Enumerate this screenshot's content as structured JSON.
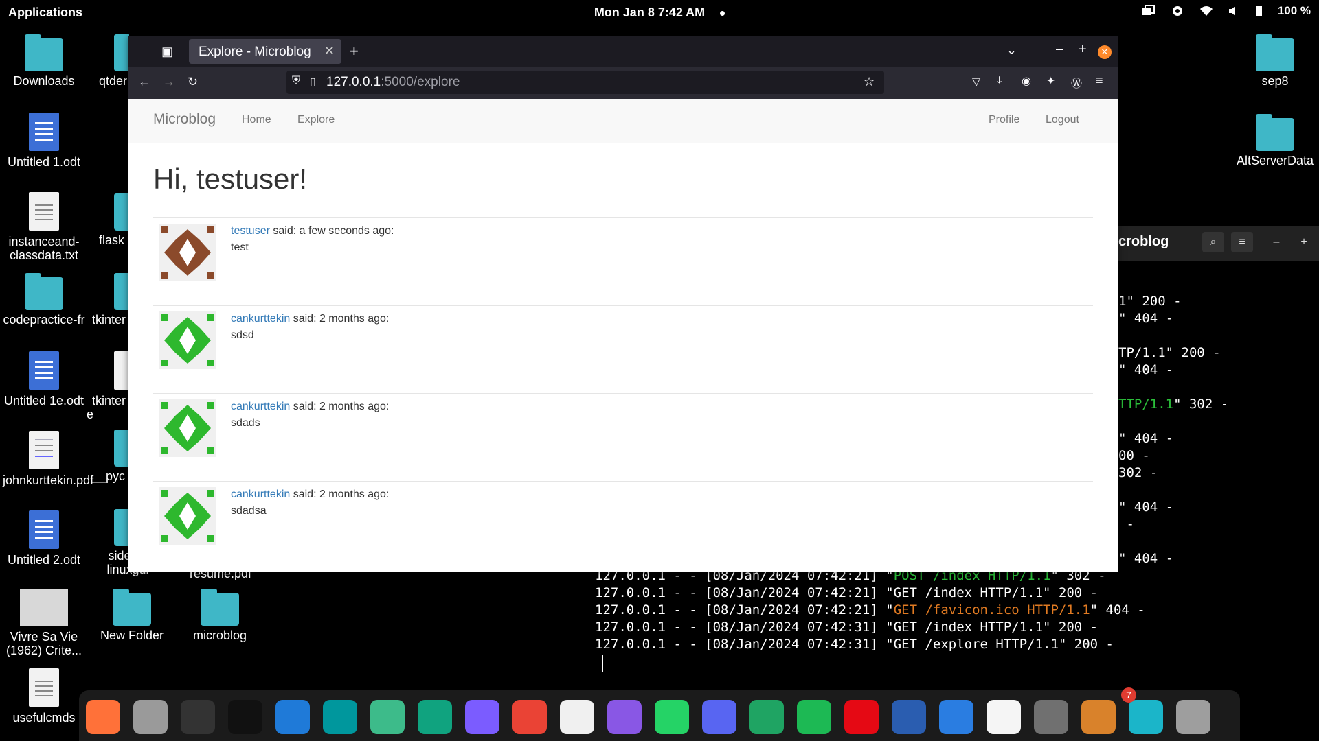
{
  "topbar": {
    "applications": "Applications",
    "datetime": "Mon Jan 8   7:42 AM",
    "battery": "100 %"
  },
  "desktop_icons": [
    {
      "label": "Downloads"
    },
    {
      "label": "Untitled 1.odt"
    },
    {
      "label": "instanceand-classdata.txt"
    },
    {
      "label": "codepractice-fr"
    },
    {
      "label": "Untitled 1e.odt"
    },
    {
      "label": "johnkurttekin.pdf"
    },
    {
      "label": "Untitled 2.odt"
    },
    {
      "label": "Vivre Sa Vie (1962) Crite..."
    },
    {
      "label": "usefulcmds"
    },
    {
      "label": "qtder"
    },
    {
      "label": "flask"
    },
    {
      "label": "tkinter"
    },
    {
      "label": "tkinter e"
    },
    {
      "label": "__pyc"
    },
    {
      "label": "sideloa linuxgui"
    },
    {
      "label": "New Folder"
    },
    {
      "label": "microblog"
    },
    {
      "label": "resume.pdf"
    },
    {
      "label": "sep8"
    },
    {
      "label": "AltServerData"
    }
  ],
  "terminal": {
    "title": "croblog",
    "lines": [
      "1\" 200 -",
      "\" 404 -",
      "TP/1.1\" 200 -",
      "\" 404 -",
      "TTP/1.1\" 302 -",
      "\" 404 -",
      "00 -",
      "302 -",
      "\" 404 -",
      " -",
      "\" 404 -",
      "127.0.0.1 - - [08/Jan/2024 07:42:21] \"POST /index HTTP/1.1\" 302 -",
      "127.0.0.1 - - [08/Jan/2024 07:42:21] \"GET /index HTTP/1.1\" 200 -",
      "127.0.0.1 - - [08/Jan/2024 07:42:21] \"GET /favicon.ico HTTP/1.1\" 404 -",
      "127.0.0.1 - - [08/Jan/2024 07:42:31] \"GET /index HTTP/1.1\" 200 -",
      "127.0.0.1 - - [08/Jan/2024 07:42:31] \"GET /explore HTTP/1.1\" 200 -"
    ],
    "partial_lines": {
      "l0": "1\" 200 -",
      "l1": "\" 404 -",
      "l2": "TP/1.1\" 200 -",
      "l3": "\" 404 -",
      "l4a": "TTP/1.1",
      "l4b": "\" 302 -",
      "l5": "\" 404 -",
      "l6": "00 -",
      "l7": "302 -",
      "l8": "\" 404 -",
      "l9": " -",
      "l10": "\" 404 -"
    },
    "full_lines": {
      "f1a": "127.0.0.1 - - [08/Jan/2024 07:42:21] \"",
      "f1b": "POST /index HTTP/1.1",
      "f1c": "\" 302 -",
      "f2": "127.0.0.1 - - [08/Jan/2024 07:42:21] \"GET /index HTTP/1.1\" 200 -",
      "f3a": "127.0.0.1 - - [08/Jan/2024 07:42:21] \"",
      "f3b": "GET /favicon.ico HTTP/1.1",
      "f3c": "\" 404 -",
      "f4": "127.0.0.1 - - [08/Jan/2024 07:42:31] \"GET /index HTTP/1.1\" 200 -",
      "f5": "127.0.0.1 - - [08/Jan/2024 07:42:31] \"GET /explore HTTP/1.1\" 200 -"
    }
  },
  "browser": {
    "tab_title": "Explore - Microblog",
    "url_host": "127.0.0.1",
    "url_rest": ":5000/explore"
  },
  "app": {
    "brand": "Microblog",
    "nav": {
      "home": "Home",
      "explore": "Explore",
      "profile": "Profile",
      "logout": "Logout"
    },
    "greeting": "Hi, testuser!",
    "posts": [
      {
        "author": "testuser",
        "said": " said: a few seconds ago:",
        "body": "test",
        "avatar_color": "#8b4a2b"
      },
      {
        "author": "cankurttekin",
        "said": " said: 2 months ago:",
        "body": "sdsd",
        "avatar_color": "#2eb82e"
      },
      {
        "author": "cankurttekin",
        "said": " said: 2 months ago:",
        "body": "sdads",
        "avatar_color": "#2eb82e"
      },
      {
        "author": "cankurttekin",
        "said": " said: 2 months ago:",
        "body": "sdadsa",
        "avatar_color": "#2eb82e"
      }
    ]
  },
  "dock": {
    "badge": "7",
    "icons": [
      "firefox-icon",
      "files-icon",
      "terminal-icon",
      "intellij-icon",
      "vscode-icon",
      "arduino-icon",
      "atom-icon",
      "chatgpt-icon",
      "mail-icon",
      "gmail-icon",
      "github-icon",
      "github-desktop-icon",
      "whatsapp-icon",
      "discord-icon",
      "google-drive-icon",
      "spotify-icon",
      "netflix-icon",
      "writer-icon",
      "window-icon",
      "text-editor-icon",
      "settings-icon",
      "launcher-icon",
      "box-icon",
      "trash-icon"
    ]
  }
}
